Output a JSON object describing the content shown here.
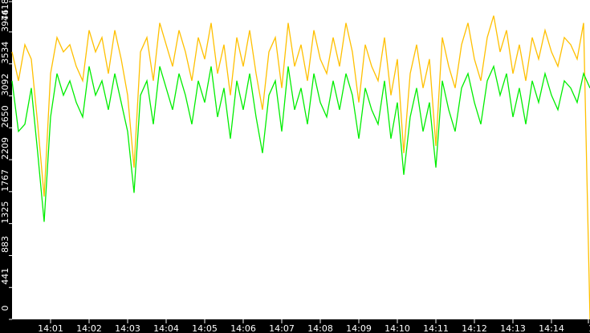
{
  "chart_data": {
    "type": "line",
    "title": "",
    "xlabel": "",
    "ylabel": "",
    "x_unit": "seconds after 14:00:00",
    "xlim": [
      0,
      900
    ],
    "ylim": [
      0,
      4418
    ],
    "y_ticks": [
      "0",
      "441",
      "883",
      "1325",
      "1767",
      "2209",
      "2650",
      "3092",
      "3534",
      "3976",
      "4418"
    ],
    "x_ticks": [
      {
        "t": 60,
        "label": "14:01"
      },
      {
        "t": 120,
        "label": "14:02"
      },
      {
        "t": 180,
        "label": "14:03"
      },
      {
        "t": 240,
        "label": "14:04"
      },
      {
        "t": 300,
        "label": "14:05"
      },
      {
        "t": 360,
        "label": "14:06"
      },
      {
        "t": 420,
        "label": "14:07"
      },
      {
        "t": 480,
        "label": "14:08"
      },
      {
        "t": 540,
        "label": "14:09"
      },
      {
        "t": 600,
        "label": "14:10"
      },
      {
        "t": 660,
        "label": "14:11"
      },
      {
        "t": 720,
        "label": "14:12"
      },
      {
        "t": 780,
        "label": "14:13"
      },
      {
        "t": 840,
        "label": "14:14"
      },
      {
        "t": 900,
        "label": "14"
      }
    ],
    "x_step": 10,
    "series": [
      {
        "name": "upper",
        "color": "#ffc000",
        "values": [
          3700,
          3300,
          3800,
          3600,
          2700,
          1700,
          3400,
          3900,
          3700,
          3800,
          3500,
          3300,
          4000,
          3700,
          3900,
          3400,
          4000,
          3600,
          3100,
          2100,
          3700,
          3900,
          3300,
          4100,
          3800,
          3500,
          4000,
          3700,
          3300,
          3900,
          3600,
          4100,
          3400,
          3800,
          3100,
          3900,
          3500,
          4000,
          3400,
          2900,
          3700,
          3900,
          3200,
          4100,
          3500,
          3800,
          3300,
          4000,
          3600,
          3400,
          3900,
          3500,
          4100,
          3700,
          3000,
          3800,
          3500,
          3300,
          3900,
          3100,
          3600,
          2300,
          3400,
          3800,
          3200,
          3600,
          2400,
          3900,
          3500,
          3200,
          3800,
          4100,
          3600,
          3300,
          3900,
          4200,
          3700,
          4000,
          3400,
          3800,
          3300,
          3900,
          3600,
          4000,
          3700,
          3500,
          3900,
          3800,
          3600,
          4100,
          0
        ]
      },
      {
        "name": "lower",
        "color": "#00ee00",
        "values": [
          3300,
          2600,
          2700,
          3200,
          2300,
          1350,
          2800,
          3400,
          3100,
          3300,
          3000,
          2800,
          3500,
          3100,
          3300,
          2900,
          3400,
          3000,
          2600,
          1750,
          3100,
          3300,
          2700,
          3500,
          3200,
          2900,
          3400,
          3100,
          2700,
          3300,
          3000,
          3500,
          2800,
          3200,
          2500,
          3300,
          2900,
          3400,
          2800,
          2300,
          3100,
          3300,
          2600,
          3500,
          2900,
          3200,
          2700,
          3400,
          3000,
          2800,
          3300,
          2900,
          3400,
          3100,
          2500,
          3200,
          2900,
          2700,
          3300,
          2500,
          3000,
          2000,
          2800,
          3200,
          2600,
          3000,
          2100,
          3300,
          2900,
          2600,
          3200,
          3400,
          3000,
          2700,
          3300,
          3500,
          3100,
          3400,
          2800,
          3200,
          2700,
          3300,
          3000,
          3400,
          3100,
          2900,
          3300,
          3200,
          3000,
          3400,
          3200
        ]
      }
    ]
  }
}
